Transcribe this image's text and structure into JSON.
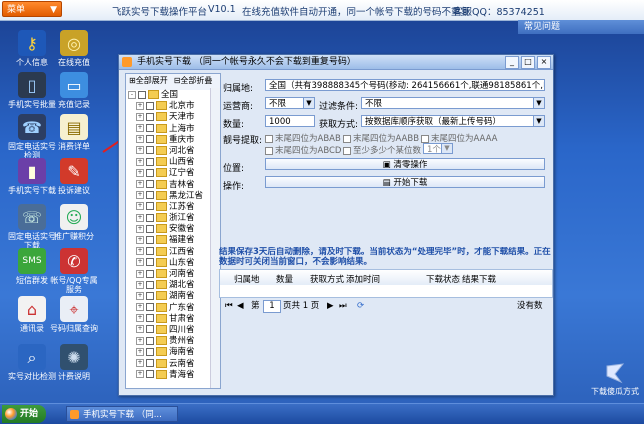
{
  "topbar": {
    "menu_label": "菜单",
    "menu_arrow": "▼",
    "app_title": "飞跃实号下载操作平台",
    "version": "V10.1",
    "notice": "在线充值软件自动开通，同一个帐号下载的号码不重复",
    "service_qq": "客服QQ：85374251"
  },
  "faq": {
    "label": "常见问题"
  },
  "desktop_icons": [
    {
      "label": "个人信息"
    },
    {
      "label": "在线充值"
    },
    {
      "label": "手机实号批量"
    },
    {
      "label": "充值记录"
    },
    {
      "label": "固定电话实号检测"
    },
    {
      "label": "消费详单"
    },
    {
      "label": "手机实号下载"
    },
    {
      "label": "投诉建议"
    },
    {
      "label": "固定电话实号下载"
    },
    {
      "label": "推广赚积分"
    },
    {
      "label": "短信群发"
    },
    {
      "label": "帐号/QQ专属服务"
    },
    {
      "label": "通讯录"
    },
    {
      "label": "号码归属查询"
    },
    {
      "label": "实号对比检测"
    },
    {
      "label": "计费说明"
    }
  ],
  "window": {
    "title": "手机实号下载 （同一个帐号永久不会下载到重复号码）",
    "ctrl_min": "_",
    "ctrl_max": "□",
    "ctrl_close": "×"
  },
  "tree": {
    "expand_all": "全部展开",
    "collapse_all": "全部折叠",
    "root": "全国",
    "provinces": [
      "北京市",
      "天津市",
      "上海市",
      "重庆市",
      "河北省",
      "山西省",
      "辽宁省",
      "吉林省",
      "黑龙江省",
      "江苏省",
      "浙江省",
      "安徽省",
      "福建省",
      "江西省",
      "山东省",
      "河南省",
      "湖北省",
      "湖南省",
      "广东省",
      "甘肃省",
      "四川省",
      "贵州省",
      "海南省",
      "云南省",
      "青海省"
    ]
  },
  "form": {
    "region_label": "归属地:",
    "region_value": "全国（共有398888345个号码(移动: 264156661个,联通98185861个,电信36475",
    "operator_label": "运营商:",
    "operator_value": "不限",
    "filter_label": "过滤条件:",
    "filter_value": "不限",
    "qty_label": "数量:",
    "qty_value": "1000",
    "method_label": "获取方式:",
    "method_value": "按数据库顺序获取（最新上传号码）",
    "pick_label": "靓号提取:",
    "options": [
      "末尾四位为ABAB",
      "末尾四位为AABB",
      "末尾四位为AAAA",
      "末尾四位为ABCD",
      "至少多少个某位数"
    ],
    "count_select": "1个",
    "location_label": "位置:",
    "location_btn": "清零操作",
    "operate_label": "操作:",
    "download_btn": "开始下载"
  },
  "result": {
    "notice": "结果保存3天后自动删除，请及时下载。当前状态为“处理完毕”时，才能下载结果。正在处理",
    "notice2": "数据时可关闭当前窗口，不会影响结果。",
    "columns": [
      "归属地",
      "数量",
      "获取方式",
      "添加时间",
      "下载状态",
      "结果下载"
    ]
  },
  "pager": {
    "first": "⏮",
    "prev": "◀",
    "label_di": "第",
    "page": "1",
    "page_total": "页共 1 页",
    "next": "▶",
    "last": "⏭",
    "refresh": "⟳",
    "no_data": "没有数"
  },
  "taskbar": {
    "start": "开始",
    "item": "手机实号下载 （同..."
  },
  "logo": {
    "label": "下载傻瓜方式"
  },
  "colors": {
    "accent": "#2a66c9",
    "menu": "#e25c00",
    "notice": "#1f4fa8"
  }
}
